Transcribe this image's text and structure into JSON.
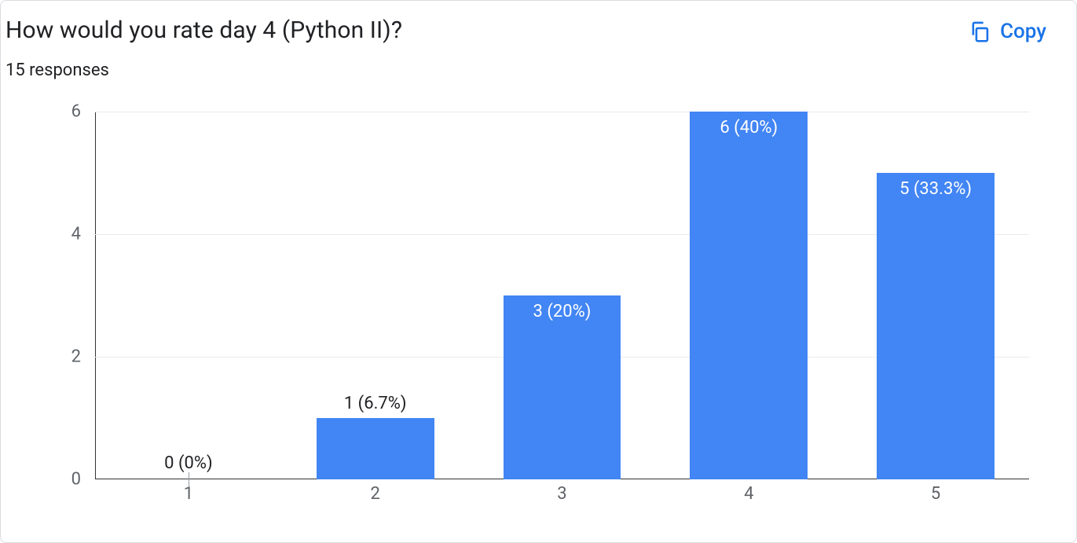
{
  "header": {
    "title": "How would you rate day 4 (Python II)?",
    "copy_label": "Copy"
  },
  "subtitle": "15 responses",
  "chart_data": {
    "type": "bar",
    "categories": [
      "1",
      "2",
      "3",
      "4",
      "5"
    ],
    "values": [
      0,
      1,
      3,
      6,
      5
    ],
    "percentages": [
      "0%",
      "6.7%",
      "20%",
      "40%",
      "33.3%"
    ],
    "data_labels": [
      "0 (0%)",
      "1 (6.7%)",
      "3 (20%)",
      "6 (40%)",
      "5 (33.3%)"
    ],
    "title": "How would you rate day 4 (Python II)?",
    "xlabel": "",
    "ylabel": "",
    "ylim": [
      0,
      6
    ],
    "y_ticks": [
      0,
      2,
      4,
      6
    ],
    "bar_color": "#4285f4"
  }
}
